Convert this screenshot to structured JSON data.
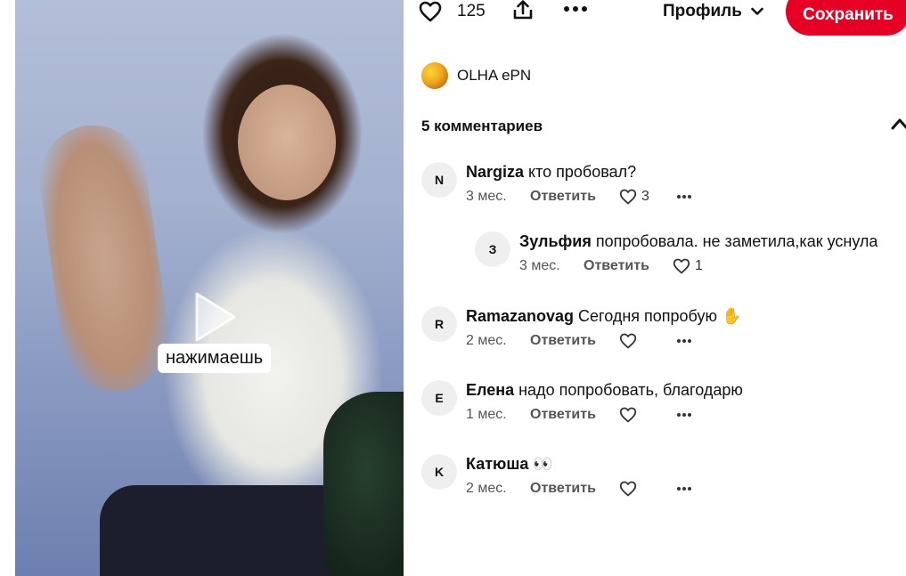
{
  "video": {
    "caption": "нажимаешь"
  },
  "topbar": {
    "likes_count": "125",
    "profile_label": "Профиль",
    "save_label": "Сохранить"
  },
  "author": {
    "name": "OLHA ePN"
  },
  "comments": {
    "header": "5 комментариев",
    "items": [
      {
        "initial": "N",
        "user": "Nargiza",
        "text": "кто пробовал?",
        "time": "3 мес.",
        "reply": "Ответить",
        "likes": "3"
      },
      {
        "initial": "З",
        "user": "Зульфия",
        "text": "попробовала. не заметила,как уснула",
        "time": "3 мес.",
        "reply": "Ответить",
        "likes": "1"
      },
      {
        "initial": "R",
        "user": "Ramazanovag",
        "text": "Сегодня попробую ✋",
        "time": "2 мес.",
        "reply": "Ответить",
        "likes": ""
      },
      {
        "initial": "E",
        "user": "Елена",
        "text": "надо попробовать, благодарю",
        "time": "1 мес.",
        "reply": "Ответить",
        "likes": ""
      },
      {
        "initial": "K",
        "user": "Катюша",
        "text": "👀",
        "time": "2 мес.",
        "reply": "Ответить",
        "likes": ""
      }
    ]
  }
}
